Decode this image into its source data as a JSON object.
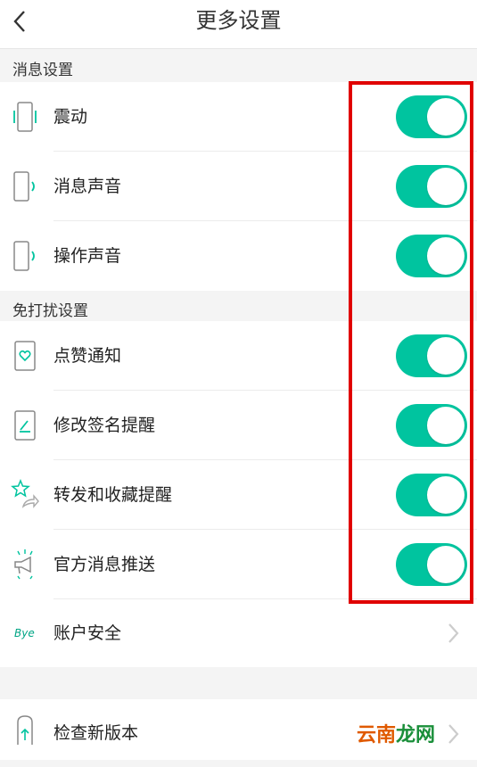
{
  "header": {
    "title": "更多设置"
  },
  "sections": {
    "messages": {
      "title": "消息设置"
    },
    "dnd": {
      "title": "免打扰设置"
    }
  },
  "items": {
    "vibrate": {
      "label": "震动",
      "icon": "phone-vibrate-icon",
      "on": true
    },
    "message_sound": {
      "label": "消息声音",
      "icon": "phone-sound-icon",
      "on": true
    },
    "operation_sound": {
      "label": "操作声音",
      "icon": "phone-sound-icon",
      "on": true
    },
    "like_notify": {
      "label": "点赞通知",
      "icon": "phone-heart-icon",
      "on": true
    },
    "signature_edit": {
      "label": "修改签名提醒",
      "icon": "phone-edit-icon",
      "on": true
    },
    "share_fav": {
      "label": "转发和收藏提醒",
      "icon": "star-share-icon",
      "on": true
    },
    "official_push": {
      "label": "官方消息推送",
      "icon": "megaphone-icon",
      "on": true
    },
    "account_security": {
      "label": "账户安全",
      "icon_text": "Bye"
    },
    "check_update": {
      "label": "检查新版本",
      "icon": "phone-update-icon"
    }
  },
  "watermark": {
    "part_a": "云南",
    "part_b": "龙网"
  },
  "colors": {
    "accent": "#00c49f",
    "highlight": "#e00000"
  }
}
